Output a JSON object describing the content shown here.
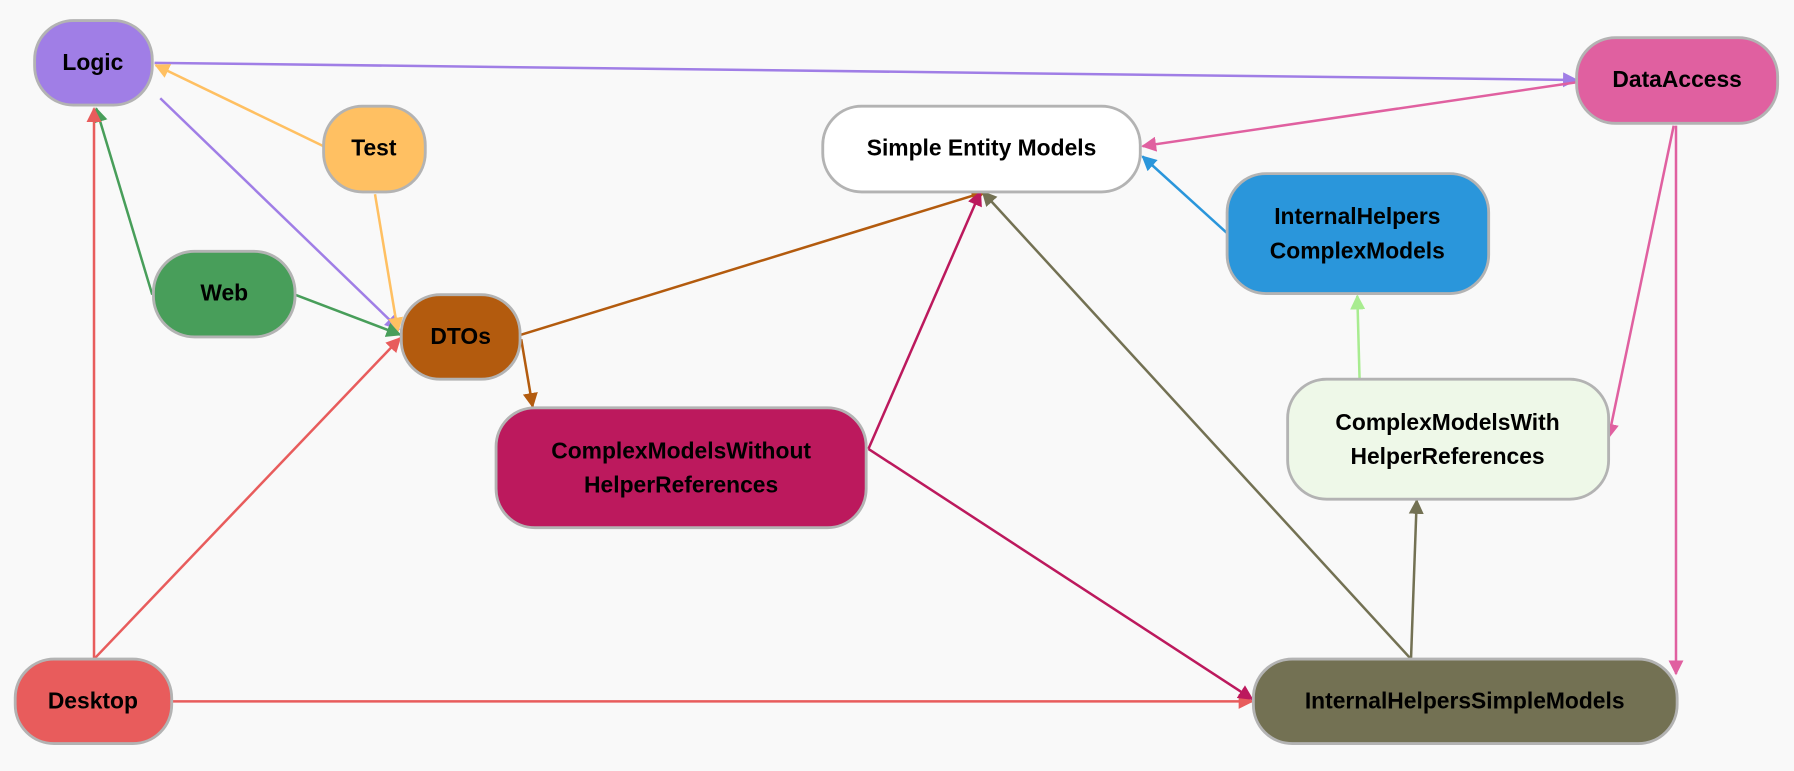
{
  "nodes": {
    "logic": {
      "label": "Logic",
      "color": "#a07ee6"
    },
    "test": {
      "label": "Test",
      "color": "#ffc062"
    },
    "web": {
      "label": "Web",
      "color": "#489e5a"
    },
    "dtos": {
      "label": "DTOs",
      "color": "#b35b0e"
    },
    "desktop": {
      "label": "Desktop",
      "color": "#e85c5c"
    },
    "simple": {
      "label": "Simple Entity Models",
      "color": "#ffffff"
    },
    "cmwithout": {
      "label1": "ComplexModelsWithout",
      "label2": "HelperReferences",
      "color": "#bc195d"
    },
    "ihcomplex": {
      "label1": "InternalHelpers",
      "label2": "ComplexModels",
      "color": "#2a96db"
    },
    "cmwith": {
      "label1": "ComplexModelsWith",
      "label2": "HelperReferences",
      "color": "#eef8e8"
    },
    "dataaccess": {
      "label": "DataAccess",
      "color": "#e060a0"
    },
    "ihsimple": {
      "label": "InternalHelpersSimpleModels",
      "color": "#737153"
    }
  },
  "edges": [
    {
      "from": "Logic",
      "to": "DataAccess"
    },
    {
      "from": "Logic",
      "to": "DTOs"
    },
    {
      "from": "Test",
      "to": "Logic"
    },
    {
      "from": "Test",
      "to": "DTOs"
    },
    {
      "from": "Web",
      "to": "Logic"
    },
    {
      "from": "Web",
      "to": "DTOs"
    },
    {
      "from": "Desktop",
      "to": "Logic"
    },
    {
      "from": "Desktop",
      "to": "DTOs"
    },
    {
      "from": "Desktop",
      "to": "InternalHelpersSimpleModels"
    },
    {
      "from": "DTOs",
      "to": "Simple Entity Models"
    },
    {
      "from": "DTOs",
      "to": "ComplexModelsWithoutHelperReferences"
    },
    {
      "from": "ComplexModelsWithoutHelperReferences",
      "to": "Simple Entity Models"
    },
    {
      "from": "ComplexModelsWithoutHelperReferences",
      "to": "InternalHelpersSimpleModels"
    },
    {
      "from": "InternalHelpersSimpleModels",
      "to": "Simple Entity Models"
    },
    {
      "from": "InternalHelpersSimpleModels",
      "to": "ComplexModelsWithHelperReferences"
    },
    {
      "from": "ComplexModelsWithHelperReferences",
      "to": "InternalHelpersComplexModels"
    },
    {
      "from": "InternalHelpersComplexModels",
      "to": "Simple Entity Models"
    },
    {
      "from": "DataAccess",
      "to": "Simple Entity Models"
    },
    {
      "from": "DataAccess",
      "to": "ComplexModelsWithHelperReferences"
    },
    {
      "from": "DataAccess",
      "to": "InternalHelpersSimpleModels"
    }
  ]
}
